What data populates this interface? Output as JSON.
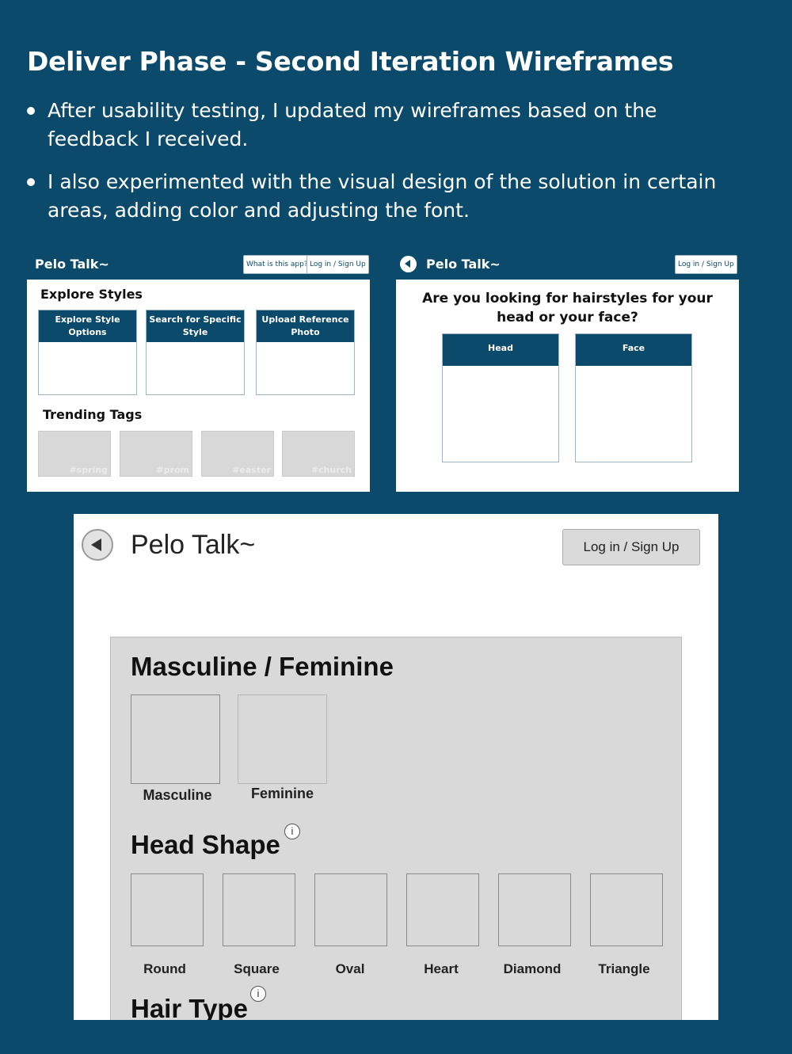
{
  "slide": {
    "title": "Deliver Phase - Second Iteration Wireframes",
    "bullets": [
      "After usability testing, I updated my wireframes based on the feedback I received.",
      "I also experimented with the visual design of the solution in certain areas, adding color and adjusting the font."
    ]
  },
  "wireframe_home": {
    "brand": "Pelo Talk~",
    "what_button": "What is this app?",
    "login_button": "Log in / Sign Up",
    "explore_heading": "Explore Styles",
    "cards": [
      "Explore Style Options",
      "Search for Specific Style",
      "Upload Reference Photo"
    ],
    "trending_heading": "Trending Tags",
    "tags": [
      "#spring",
      "#prom",
      "#easter",
      "#church"
    ]
  },
  "wireframe_choice": {
    "brand": "Pelo Talk~",
    "login_button": "Log in / Sign Up",
    "question": "Are you looking for hairstyles for your head or your face?",
    "options": [
      "Head",
      "Face"
    ]
  },
  "wireframe_head": {
    "brand": "Pelo Talk~",
    "login_button": "Log in / Sign Up",
    "gender_heading": "Masculine / Feminine",
    "gender_options": [
      "Masculine",
      "Feminine"
    ],
    "head_shape_heading": "Head Shape",
    "info_glyph": "i",
    "head_shapes": [
      "Round",
      "Square",
      "Oval",
      "Heart",
      "Diamond",
      "Triangle"
    ],
    "hair_type_heading": "Hair Type"
  },
  "colors": {
    "background": "#0b4a6b",
    "header_bar": "#0b4a6b",
    "wireframe_gray": "#d9d9d9"
  }
}
